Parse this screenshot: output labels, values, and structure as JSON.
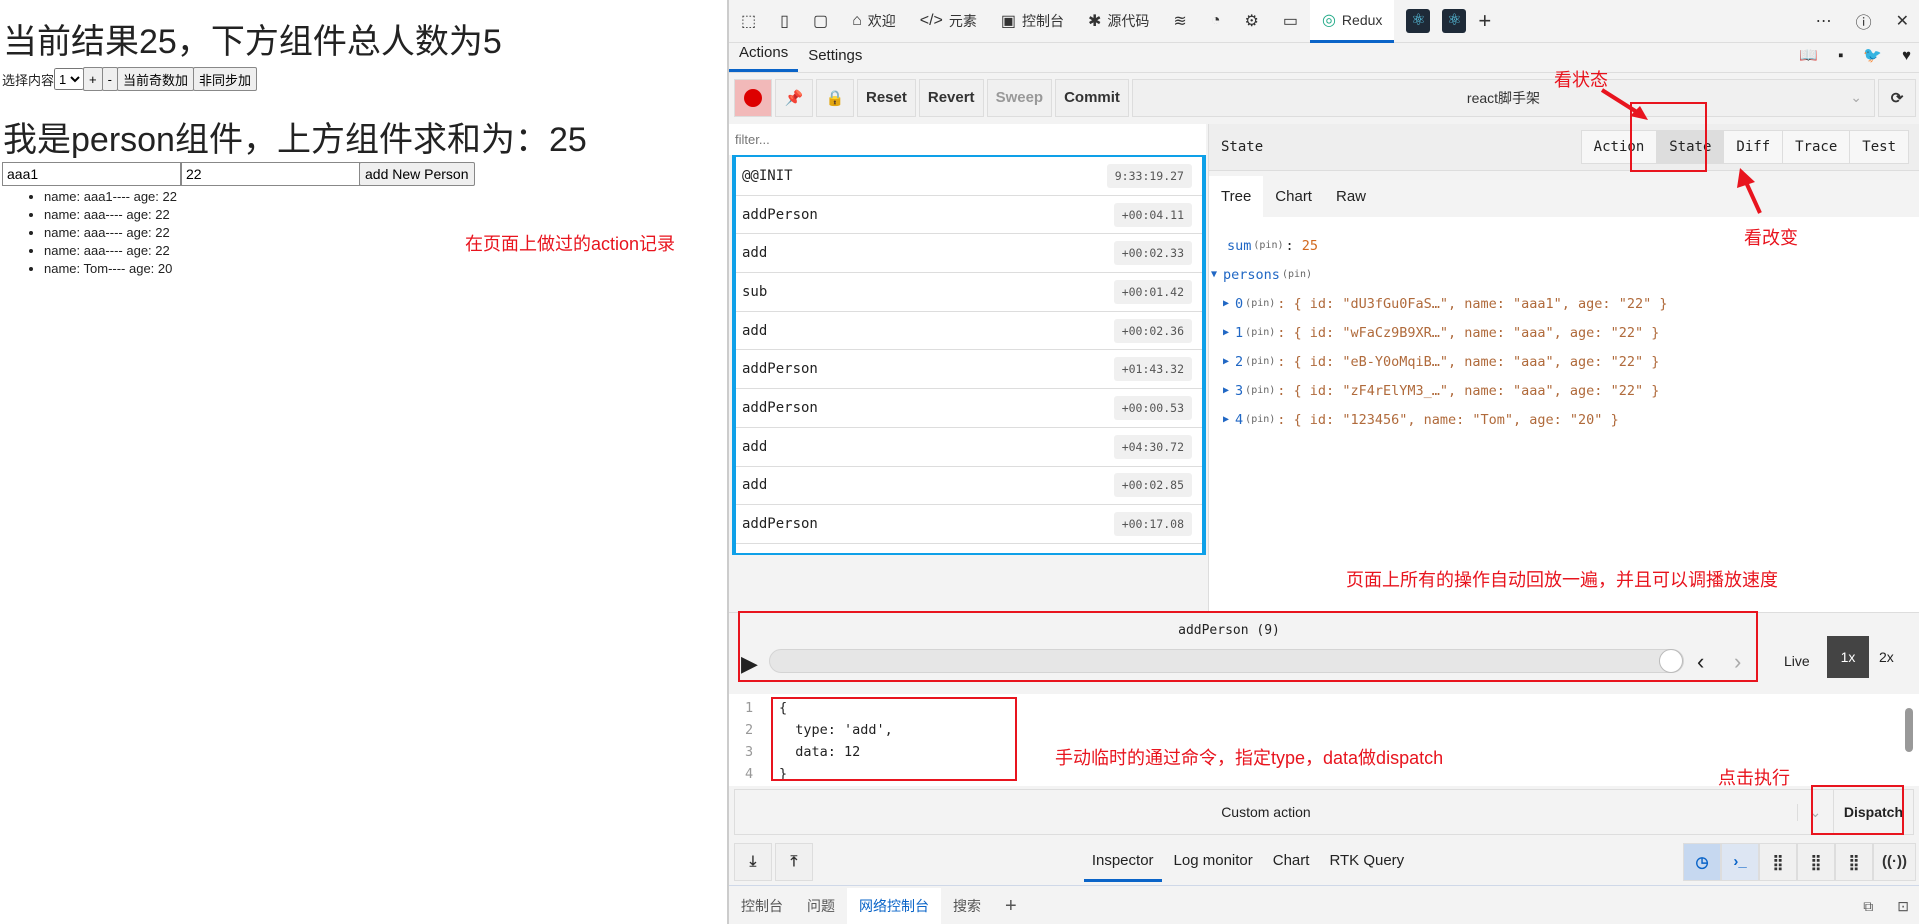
{
  "page": {
    "title": "当前结果25，下方组件总人数为5",
    "select_label": "选择内容",
    "select_value": "1",
    "buttons": [
      "+",
      "-",
      "当前奇数加",
      "非同步加"
    ],
    "person_title": "我是person组件，上方组件求和为：25",
    "name_input": "aaa1",
    "age_input": "22",
    "add_button": "add New Person",
    "persons": [
      "name: aaa1---- age: 22",
      "name: aaa---- age: 22",
      "name: aaa---- age: 22",
      "name: aaa---- age: 22",
      "name: Tom---- age: 20"
    ]
  },
  "devtools": {
    "tabs": [
      "欢迎",
      "元素",
      "控制台",
      "源代码",
      "Redux"
    ],
    "subtabs": [
      "Actions",
      "Settings"
    ],
    "toolbar": {
      "reset": "Reset",
      "revert": "Revert",
      "sweep": "Sweep",
      "commit": "Commit",
      "instance": "react脚手架"
    },
    "filter_placeholder": "filter...",
    "actions": [
      {
        "name": "@@INIT",
        "time": "9:33:19.27"
      },
      {
        "name": "addPerson",
        "time": "+00:04.11"
      },
      {
        "name": "add",
        "time": "+00:02.33"
      },
      {
        "name": "sub",
        "time": "+00:01.42"
      },
      {
        "name": "add",
        "time": "+00:02.36"
      },
      {
        "name": "addPerson",
        "time": "+01:43.32"
      },
      {
        "name": "addPerson",
        "time": "+00:00.53"
      },
      {
        "name": "add",
        "time": "+04:30.72"
      },
      {
        "name": "add",
        "time": "+00:02.85"
      },
      {
        "name": "addPerson",
        "time": "+00:17.08"
      }
    ],
    "state_header": "State",
    "view_tabs": [
      "Action",
      "State",
      "Diff",
      "Trace",
      "Test"
    ],
    "active_view": "State",
    "tree_tabs": [
      "Tree",
      "Chart",
      "Raw"
    ],
    "tree": {
      "sum_key": "sum",
      "pin": "(pin)",
      "sum_value": "25",
      "persons_key": "persons",
      "items": [
        {
          "idx": "0",
          "id": "\"dU3fGu0FaS…\"",
          "name": "\"aaa1\"",
          "age": "\"22\""
        },
        {
          "idx": "1",
          "id": "\"wFaCz9B9XR…\"",
          "name": "\"aaa\"",
          "age": "\"22\""
        },
        {
          "idx": "2",
          "id": "\"eB-Y0oMqiB…\"",
          "name": "\"aaa\"",
          "age": "\"22\""
        },
        {
          "idx": "3",
          "id": "\"zF4rElYM3_…\"",
          "name": "\"aaa\"",
          "age": "\"22\""
        },
        {
          "idx": "4",
          "id": "\"123456\"",
          "name": "\"Tom\"",
          "age": "\"20\""
        }
      ]
    },
    "slider": {
      "label": "addPerson (9)",
      "position": 1.0,
      "live": "Live",
      "speed_1x": "1x",
      "speed_2x": "2x",
      "active_speed": "1x"
    },
    "editor": {
      "lines": [
        "{",
        "  type: 'add',",
        "  data: 12",
        "}"
      ]
    },
    "custom_action": "Custom action",
    "dispatch": "Dispatch",
    "monitors": [
      "Inspector",
      "Log monitor",
      "Chart",
      "RTK Query"
    ],
    "drawer_tabs": [
      "控制台",
      "问题",
      "网络控制台",
      "搜索"
    ]
  },
  "annotations": {
    "view_state": "看状态",
    "view_diff": "看改变",
    "action_log": "在页面上做过的action记录",
    "replay": "页面上所有的操作自动回放一遍，并且可以调播放速度",
    "manual": "手动临时的通过命令，指定type，data做dispatch",
    "click_run": "点击执行"
  }
}
